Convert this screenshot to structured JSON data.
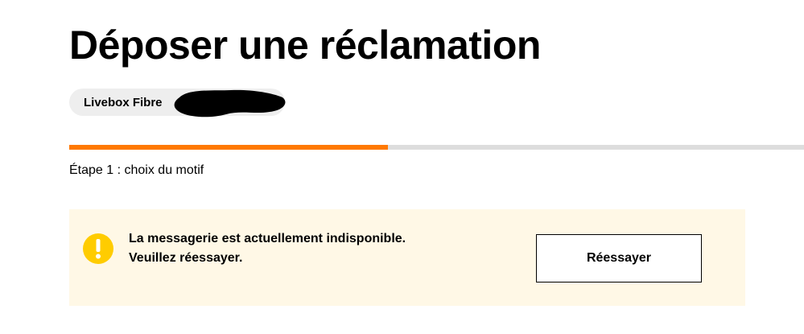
{
  "page": {
    "title": "Déposer une réclamation"
  },
  "product_chip": {
    "label": "Livebox Fibre"
  },
  "progress": {
    "fraction": 0.4336,
    "step_label": "Étape 1 : choix du motif"
  },
  "alert": {
    "icon": "warning-exclamation-icon",
    "line1": "La messagerie est actuellement indisponible.",
    "line2": "Veuillez réessayer.",
    "retry_label": "Réessayer"
  },
  "colors": {
    "accent_orange": "#ff7900",
    "progress_track": "#dddddd",
    "alert_background": "#fff8e6",
    "alert_icon": "#ffcc00",
    "chip_background": "#eeeeee"
  }
}
